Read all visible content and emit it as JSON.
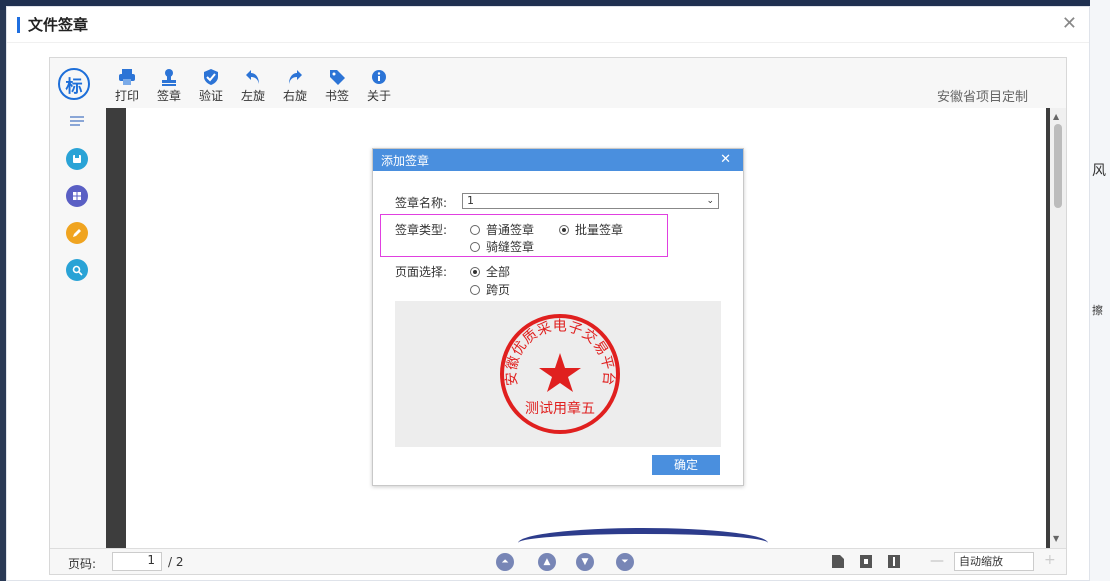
{
  "modal": {
    "title": "文件签章"
  },
  "toolbar": {
    "logo_char": "标",
    "items": [
      {
        "label": "打印",
        "icon": "printer-icon"
      },
      {
        "label": "签章",
        "icon": "stamp-icon"
      },
      {
        "label": "验证",
        "icon": "shield-check-icon"
      },
      {
        "label": "左旋",
        "icon": "rotate-left-icon"
      },
      {
        "label": "右旋",
        "icon": "rotate-right-icon"
      },
      {
        "label": "书签",
        "icon": "tag-icon"
      },
      {
        "label": "关于",
        "icon": "info-icon"
      }
    ],
    "brand": "安徽省项目定制"
  },
  "sidebar": {
    "icons": [
      "list-icon",
      "save-icon",
      "grid-icon",
      "pen-icon",
      "search-icon"
    ],
    "colors": [
      "#2aa3d6",
      "#5a5fc4",
      "#f0a420",
      "#2aa3d6"
    ]
  },
  "dialog": {
    "title": "添加签章",
    "name_label": "签章名称:",
    "name_value": "1",
    "type_label": "签章类型:",
    "type_options": [
      {
        "label": "普通签章",
        "selected": false
      },
      {
        "label": "批量签章",
        "selected": true
      },
      {
        "label": "骑缝签章",
        "selected": false
      }
    ],
    "page_label": "页面选择:",
    "page_options": [
      {
        "label": "全部",
        "selected": true
      },
      {
        "label": "跨页",
        "selected": false
      }
    ],
    "stamp": {
      "outer_text": "安徽优质采电子交易平台",
      "inner_text": "测试用章五",
      "color": "#e0201f"
    },
    "confirm_label": "确定"
  },
  "footer": {
    "page_label": "页码:",
    "page_value": "1",
    "page_total": "/ 2",
    "zoom_value": "自动缩放",
    "zoom_minus": "—",
    "zoom_plus": "+"
  },
  "background": {
    "right_chars": [
      "风",
      "擦"
    ]
  },
  "colors": {
    "accent": "#1f6fe0",
    "dialog_header": "#4a8fde",
    "highlight": "#e040e0"
  }
}
